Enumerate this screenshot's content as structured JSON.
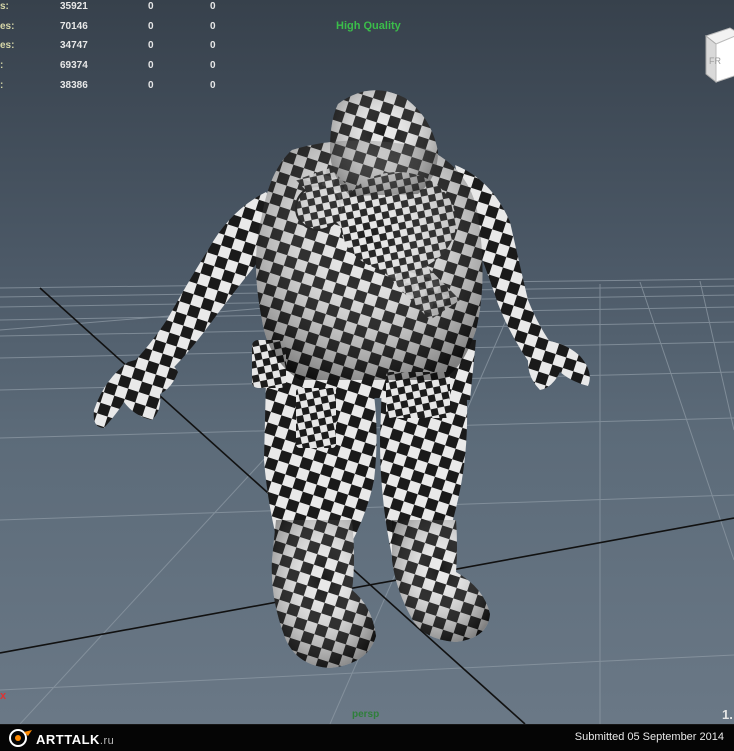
{
  "hud": {
    "rows": [
      {
        "label": "s:",
        "v1": "35921",
        "v2": "0",
        "v3": "0"
      },
      {
        "label": "es:",
        "v1": "70146",
        "v2": "0",
        "v3": "0"
      },
      {
        "label": "es:",
        "v1": "34747",
        "v2": "0",
        "v3": "0"
      },
      {
        "label": ":",
        "v1": "69374",
        "v2": "0",
        "v3": "0"
      },
      {
        "label": ":",
        "v1": "38386",
        "v2": "0",
        "v3": "0"
      }
    ],
    "quality": "High Quality",
    "bottom_label": "persp",
    "scale_label": "1.",
    "close_mark": "x",
    "view_cube_face": "FR"
  },
  "footer": {
    "logo_main": "ARTTALK",
    "logo_suffix": ".ru",
    "submitted": "Submitted 05 September 2014"
  },
  "colors": {
    "quality_text": "#3bbd4a",
    "viewport_top": "#37414c",
    "viewport_bottom": "#6a7886",
    "footer_bg": "#050505"
  }
}
